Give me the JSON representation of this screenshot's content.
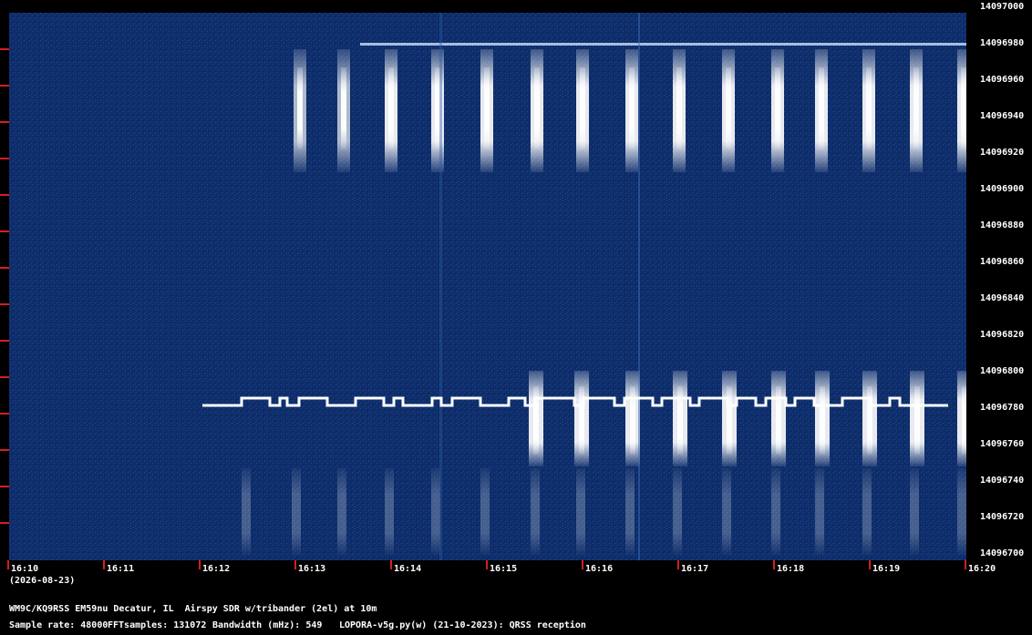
{
  "app": {
    "date": "(2026-08-23)",
    "station_line": "WM9C/KQ9RSS EM59nu Decatur, IL  Airspy SDR w/tribander (2el) at 10m",
    "sample_rate": "Sample rate: 48000",
    "fft_samples": "FFTsamples: 131072",
    "bandwidth": "Bandwidth (mHz): 549",
    "software": "LOPORA-v5g.py(w) (21-10-2023): QRSS reception"
  },
  "colors": {
    "background": "#000000",
    "waterfall_bg": "#0e2d6a",
    "tick": "#d61f1f",
    "signal": "#ffffff"
  },
  "frequency_axis": {
    "labels": [
      "14097000",
      "14096980",
      "14096960",
      "14096940",
      "14096920",
      "14096900",
      "14096880",
      "14096860",
      "14096840",
      "14096820",
      "14096800",
      "14096780",
      "14096760",
      "14096740",
      "14096720",
      "14096700"
    ]
  },
  "time_axis": {
    "labels": [
      "16:10",
      "16:11",
      "16:12",
      "16:13",
      "16:14",
      "16:15",
      "16:16",
      "16:17",
      "16:18",
      "16:19",
      "16:20"
    ]
  }
}
